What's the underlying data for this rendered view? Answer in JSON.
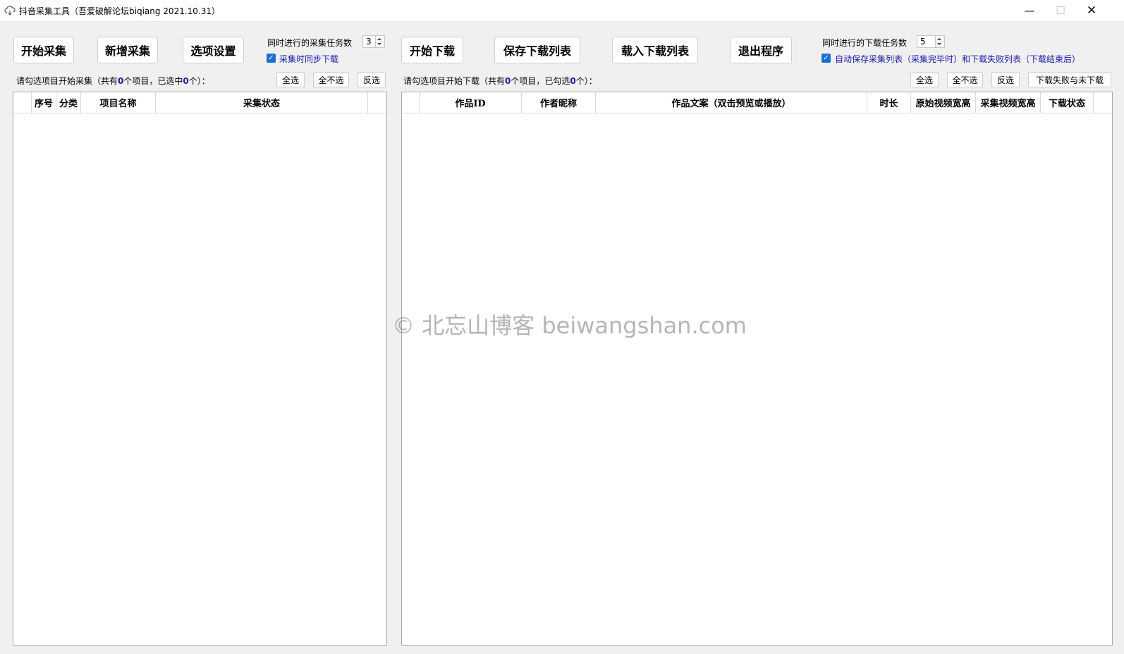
{
  "window": {
    "title": "抖音采集工具（吾爱破解论坛biqiang 2021.10.31）",
    "minimize_glyph": "—",
    "maximize_glyph": "☐",
    "close_glyph": "✕"
  },
  "toolbar": {
    "start_collect": "开始采集",
    "add_collect": "新增采集",
    "options": "选项设置",
    "start_download": "开始下载",
    "save_download_list": "保存下载列表",
    "load_download_list": "载入下载列表",
    "exit": "退出程序"
  },
  "collect_settings": {
    "concurrent_label": "同时进行的采集任务数",
    "concurrent_value": "3",
    "sync_download_label": "采集时同步下载",
    "sync_download_checked": true
  },
  "download_settings": {
    "concurrent_label": "同时进行的下载任务数",
    "concurrent_value": "5",
    "autosave_label": "自动保存采集列表（采集完毕时）和下载失败列表（下载结束后）",
    "autosave_checked": true
  },
  "collect_panel": {
    "status_prefix": "请勾选项目开始采集（共有",
    "total": "0",
    "status_mid": "个项目，已选中",
    "selected": "0",
    "status_suffix": "个）：",
    "select_all": "全选",
    "select_none": "全不选",
    "invert": "反选",
    "columns": [
      "",
      "序号",
      "分类",
      "项目名称",
      "采集状态",
      ""
    ]
  },
  "download_panel": {
    "status_prefix": "请勾选项目开始下载（共有",
    "total": "0",
    "status_mid": "个项目，已勾选",
    "selected": "0",
    "status_suffix": "个）：",
    "select_all": "全选",
    "select_none": "全不选",
    "invert": "反选",
    "failed_undownloaded": "下载失败与未下载",
    "columns": [
      "",
      "作品ID",
      "作者昵称",
      "作品文案（双击预览或播放）",
      "时长",
      "原始视频宽高",
      "采集视频宽高",
      "下载状态",
      ""
    ]
  },
  "watermark": "© 北忘山博客 beiwangshan.com",
  "colors": {
    "accent_blue": "#1b6fd1",
    "count_blue": "#1a1aa6"
  }
}
